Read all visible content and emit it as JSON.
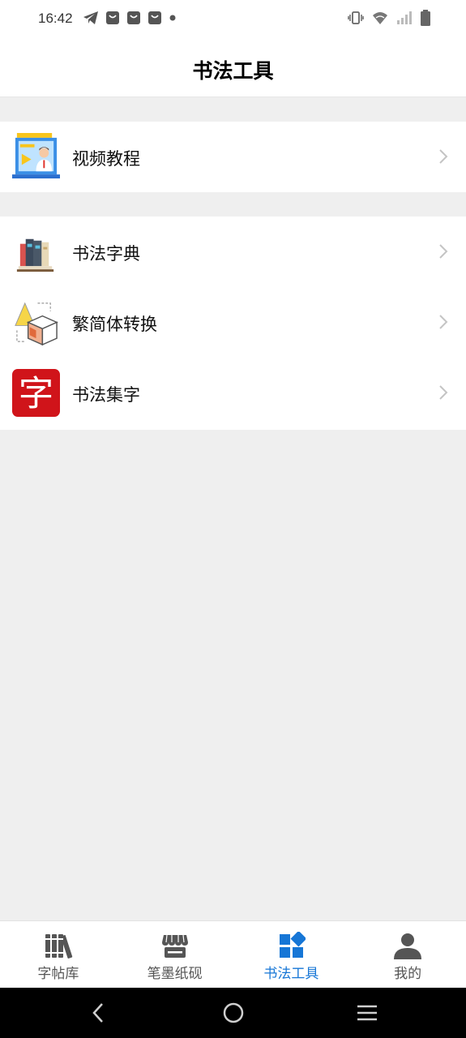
{
  "status_bar": {
    "time": "16:42",
    "left_icons": [
      "telegram-icon",
      "shopping-bag-icon",
      "shopping-bag-icon",
      "shopping-bag-icon",
      "notification-dot-icon"
    ],
    "right_icons": [
      "vibrate-icon",
      "wifi-icon",
      "signal-icon",
      "battery-icon"
    ]
  },
  "header": {
    "title": "书法工具"
  },
  "sections": [
    {
      "items": [
        {
          "label": "视频教程",
          "icon": "video-tutorial-icon"
        }
      ]
    },
    {
      "items": [
        {
          "label": "书法字典",
          "icon": "books-icon"
        },
        {
          "label": "繁简体转换",
          "icon": "shapes-convert-icon"
        },
        {
          "label": "书法集字",
          "icon": "zi-character-icon",
          "icon_text": "字"
        }
      ]
    }
  ],
  "tabs": [
    {
      "label": "字帖库",
      "icon": "library-books-icon",
      "active": false
    },
    {
      "label": "笔墨纸砚",
      "icon": "store-icon",
      "active": false
    },
    {
      "label": "书法工具",
      "icon": "tools-grid-icon",
      "active": true
    },
    {
      "label": "我的",
      "icon": "person-icon",
      "active": false
    }
  ],
  "nav_bar": {
    "buttons": [
      "back-icon",
      "home-icon",
      "menu-icon"
    ]
  },
  "colors": {
    "accent": "#1676d6",
    "background": "#efefef",
    "tab_inactive": "#555555",
    "zi_red": "#d0141a"
  }
}
